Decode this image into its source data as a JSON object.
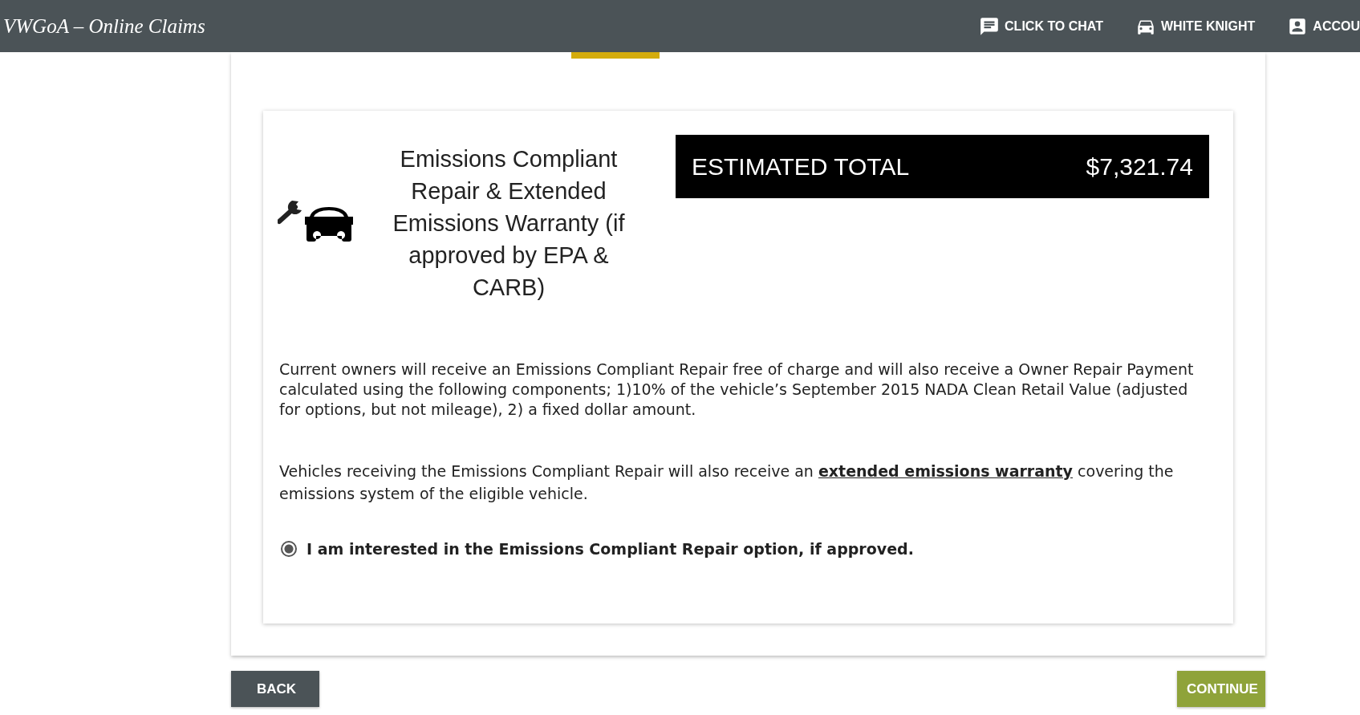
{
  "header": {
    "title": "VWGoA – Online Claims",
    "nav": [
      {
        "kind": "chat",
        "label": "CLICK TO CHAT"
      },
      {
        "kind": "car",
        "label": "WHITE KNIGHT"
      },
      {
        "kind": "account",
        "label": "ACCOU"
      }
    ]
  },
  "option": {
    "title": "Emissions Compliant Repair & Extended Emissions Warranty (if approved by EPA & CARB)",
    "total_label": "ESTIMATED TOTAL",
    "total_value": "$7,321.74",
    "paragraph_1": "Current owners will receive an Emissions Compliant Repair free of charge and will also receive a Owner Repair Payment calculated using the following components; 1)10% of the vehicle’s September 2015 NADA Clean Retail Value (adjusted for options, but not mileage), 2) a fixed dollar amount.",
    "paragraph_2": {
      "before": "Vehicles receiving the Emissions Compliant Repair will also receive an",
      "link": "extended emissions warranty",
      "after": "covering the emissions system of the eligible vehicle."
    },
    "radio": {
      "label": "I am interested in the Emissions Compliant Repair option, if approved.",
      "selected": true
    }
  },
  "buttons": {
    "back": "BACK",
    "continue": "CONTINUE"
  }
}
